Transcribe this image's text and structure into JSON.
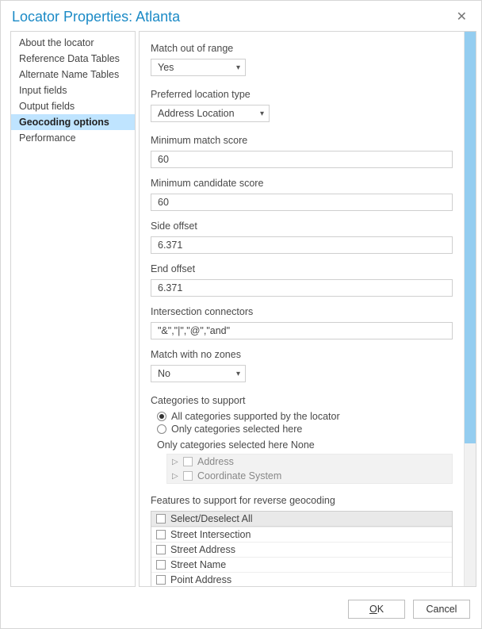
{
  "title": "Locator Properties: Atlanta",
  "sidebar": {
    "items": [
      {
        "label": "About the locator"
      },
      {
        "label": "Reference Data Tables"
      },
      {
        "label": "Alternate Name Tables"
      },
      {
        "label": "Input fields"
      },
      {
        "label": "Output fields"
      },
      {
        "label": "Geocoding options"
      },
      {
        "label": "Performance"
      }
    ],
    "activeIndex": 5
  },
  "form": {
    "matchOutOfRange": {
      "label": "Match out of range",
      "value": "Yes"
    },
    "preferredLocationType": {
      "label": "Preferred location type",
      "value": "Address Location"
    },
    "minMatchScore": {
      "label": "Minimum match score",
      "value": "60"
    },
    "minCandidateScore": {
      "label": "Minimum candidate score",
      "value": "60"
    },
    "sideOffset": {
      "label": "Side offset",
      "value": "6.371"
    },
    "endOffset": {
      "label": "End offset",
      "value": "6.371"
    },
    "intersectionConnectors": {
      "label": "Intersection connectors",
      "value": "\"&\",\"|\",\"@\",\"and\""
    },
    "matchNoZones": {
      "label": "Match with no zones",
      "value": "No"
    },
    "categories": {
      "label": "Categories to support",
      "optionAll": "All categories supported by the locator",
      "optionSelected": "Only categories selected here",
      "sublabel": "Only categories selected here None",
      "treeItems": [
        "Address",
        "Coordinate System"
      ]
    },
    "reverseFeatures": {
      "label": "Features to support for reverse geocoding",
      "header": "Select/Deselect All",
      "items": [
        "Street Intersection",
        "Street Address",
        "Street Name",
        "Point Address"
      ]
    }
  },
  "footer": {
    "ok_u": "O",
    "ok_rest": "K",
    "cancel": "Cancel"
  }
}
